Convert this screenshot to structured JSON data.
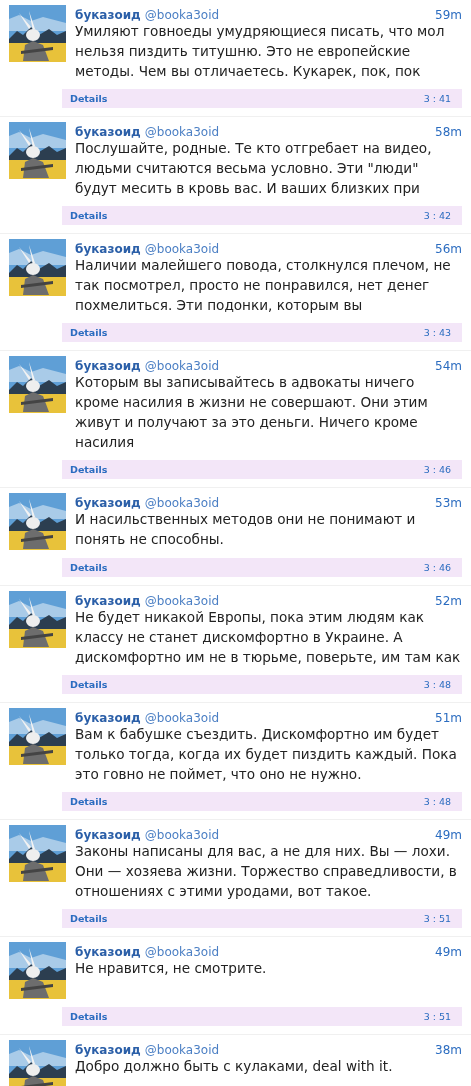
{
  "tweets": [
    {
      "name": "буказоид",
      "handle": "@booka3oid",
      "age": "59m",
      "text": "Умиляют говноеды умудряющиеся писать, что мол нельзя пиздить титушню. Это не европейские методы. Чем вы отличаетесь. Кукарек, пок, пок",
      "details": {
        "label": "Details",
        "time": "3 : 41"
      }
    },
    {
      "name": "буказоид",
      "handle": "@booka3oid",
      "age": "58m",
      "text": "Послушайте, родные. Те кто отгребает на видео, людьми считаются весьма условно. Эти \"люди\" будут месить в кровь вас. И ваших близких при",
      "details": {
        "label": "Details",
        "time": "3 : 42"
      }
    },
    {
      "name": "буказоид",
      "handle": "@booka3oid",
      "age": "56m",
      "text": "Наличии малейшего повода, столкнулся плечом, не так посмотрел, просто не понравился, нет денег похмелиться. Эти подонки, которым вы",
      "details": {
        "label": "Details",
        "time": "3 : 43"
      }
    },
    {
      "name": "буказоид",
      "handle": "@booka3oid",
      "age": "54m",
      "text": "Которым вы записывайтесь в адвокаты ничего кроме насилия в жизни не совершают. Они этим живут и получают за это деньги. Ничего кроме насилия",
      "details": {
        "label": "Details",
        "time": "3 : 46"
      }
    },
    {
      "name": "буказоид",
      "handle": "@booka3oid",
      "age": "53m",
      "text": "И насильственных методов они не понимают и понять не способны.",
      "details": {
        "label": "Details",
        "time": "3 : 46"
      }
    },
    {
      "name": "буказоид",
      "handle": "@booka3oid",
      "age": "52m",
      "text": "Не будет никакой Европы, пока этим людям как классу не станет дискомфортно в Украине. А дискомфортно им не в тюрьме, поверьте, им там как",
      "details": {
        "label": "Details",
        "time": "3 : 48"
      }
    },
    {
      "name": "буказоид",
      "handle": "@booka3oid",
      "age": "51m",
      "text": "Вам к бабушке съездить. Дискомфортно им будет только тогда, когда их будет пиздить каждый. Пока это говно не поймет, что оно не нужно.",
      "details": {
        "label": "Details",
        "time": "3 : 48"
      }
    },
    {
      "name": "буказоид",
      "handle": "@booka3oid",
      "age": "49m",
      "text": "Законы написаны для вас, а не для них. Вы — лохи. Они — хозяева жизни. Торжество справедливости, в отношениях с этими уродами, вот такое.",
      "details": {
        "label": "Details",
        "time": "3 : 51"
      }
    },
    {
      "name": "буказоид",
      "handle": "@booka3oid",
      "age": "49m",
      "text": "Не нравится, не смотрите.",
      "details": {
        "label": "Details",
        "time": "3 : 51"
      }
    },
    {
      "name": "буказоид",
      "handle": "@booka3oid",
      "age": "38m",
      "text": "Добро должно быть с кулаками, deal with it."
    }
  ]
}
